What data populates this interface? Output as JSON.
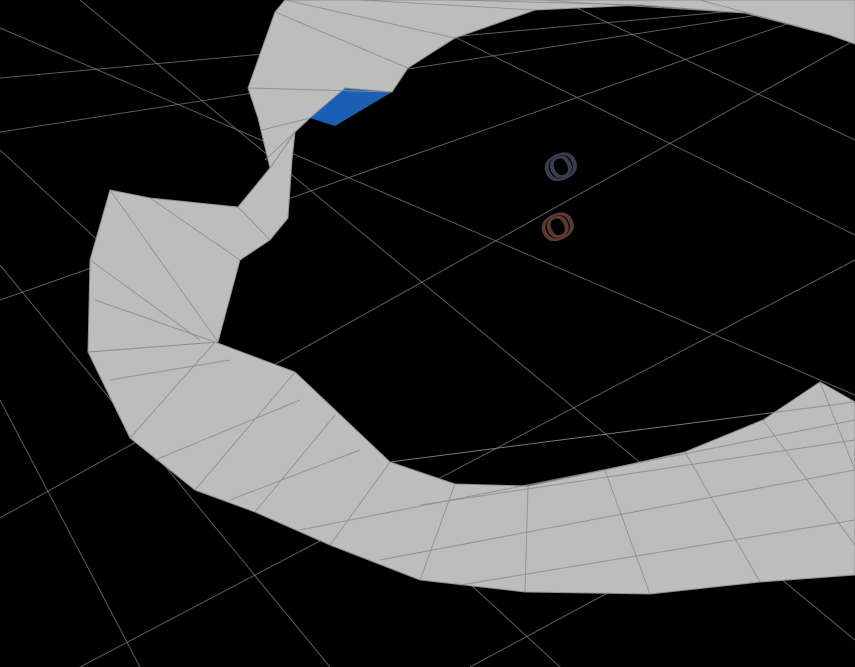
{
  "viewport": {
    "background_color": "#000000",
    "grid_color": "#6f7f88",
    "mesh_fill_color": "#bdbdbd",
    "mesh_wire_color": "#8d8d8d",
    "backface_color": "#1a5fb4"
  },
  "axis_labels": {
    "upper": {
      "text": "0",
      "color": "#3b3b52"
    },
    "lower": {
      "text": "0",
      "color": "#5a3a32"
    }
  }
}
